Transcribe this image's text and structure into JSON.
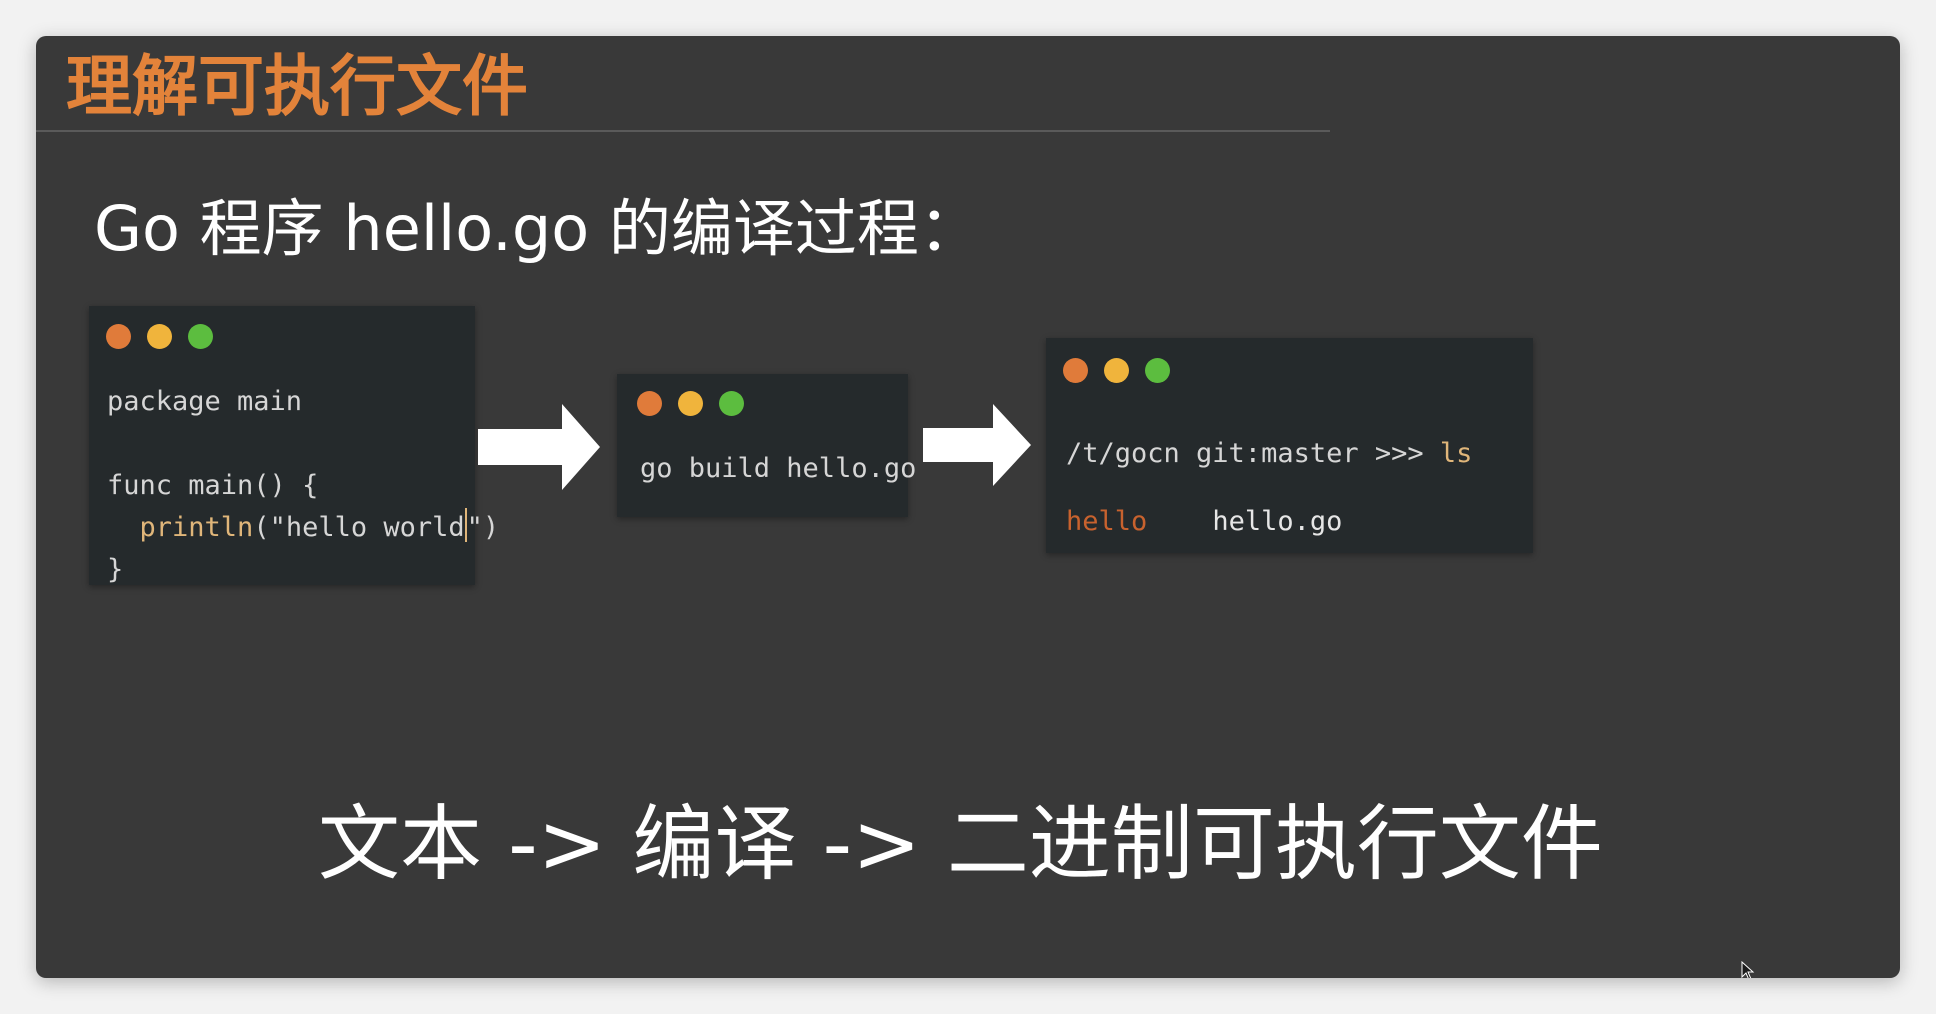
{
  "slide": {
    "title": "理解可执行文件",
    "subtitle": "Go 程序 hello.go 的编译过程：",
    "bottom_text": "文本 -> 编译 -> 二进制可执行文件"
  },
  "colors": {
    "title_orange": "#e3833a",
    "slide_bg": "#393939",
    "terminal_bg": "#252a2c",
    "dot_red": "#e07b3a",
    "dot_yellow": "#f0b43c",
    "dot_green": "#5cbd3f",
    "executable_name": "#c8622e"
  },
  "source_window": {
    "line1": "package main",
    "line3": "func main() {",
    "line4_indent": "  ",
    "line4_fn": "println",
    "line4_arg_a": "(\"hello world",
    "line4_arg_b": "\")",
    "line5": "}"
  },
  "build_window": {
    "command": "go build hello.go"
  },
  "result_window": {
    "prompt": "/t/gocn git:master >>> ",
    "command": "ls",
    "file_executable": "hello",
    "file_source": "hello.go"
  },
  "icons": {
    "arrow": "arrow-right-icon",
    "window_controls": "traffic-light-dots",
    "pointer": "mouse-cursor-icon"
  }
}
